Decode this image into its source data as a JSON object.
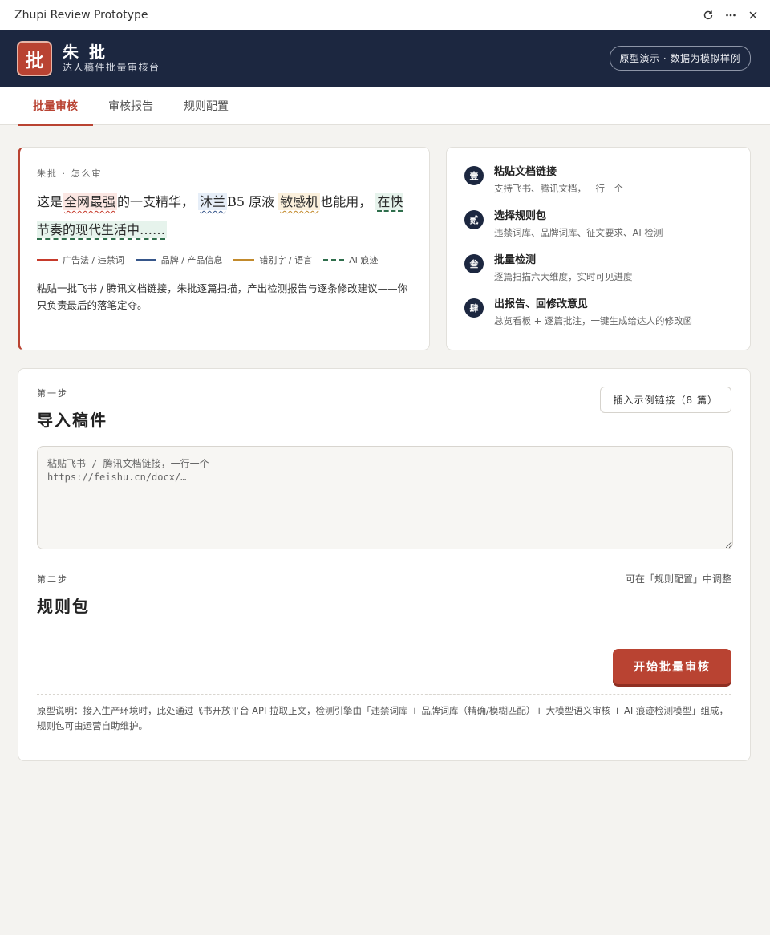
{
  "window": {
    "title": "Zhupi Review Prototype",
    "refresh_icon": "refresh-icon",
    "more_icon": "more-icon",
    "close_icon": "close-icon"
  },
  "header": {
    "logo_char": "批",
    "app_name": "朱 批",
    "subtitle": "达人稿件批量审核台",
    "pill": "原型演示 · 数据为模拟样例",
    "colors": {
      "header_bg": "#1c2740",
      "accent": "#b94332"
    }
  },
  "tabs": [
    {
      "label": "批量审核",
      "active": true
    },
    {
      "label": "审核报告",
      "active": false
    },
    {
      "label": "规则配置",
      "active": false
    }
  ],
  "intro": {
    "kicker": "朱批 · 怎么审",
    "sample": [
      {
        "text": "这是",
        "mark": ""
      },
      {
        "text": "全网最强",
        "mark": "ad"
      },
      {
        "text": "的一支精华，",
        "mark": ""
      },
      {
        "text": "沐兰",
        "mark": "brand"
      },
      {
        "text": "B5 原液",
        "mark": ""
      },
      {
        "text": "敏感机",
        "mark": "typo"
      },
      {
        "text": "也能用，",
        "mark": ""
      },
      {
        "text": "在快节奏的现代生活中……",
        "mark": "ai"
      }
    ],
    "legend": [
      {
        "label": "广告法 / 违禁词",
        "color": "#c63a2b",
        "style": "solid"
      },
      {
        "label": "品牌 / 产品信息",
        "color": "#36568a",
        "style": "solid"
      },
      {
        "label": "错别字 / 语言",
        "color": "#c28a2c",
        "style": "solid"
      },
      {
        "label": "AI 痕迹",
        "color": "#2f6e4c",
        "style": "dashed"
      }
    ],
    "description": "粘贴一批飞书 / 腾讯文档链接，朱批逐篇扫描，产出检测报告与逐条修改建议——你只负责最后的落笔定夺。"
  },
  "steps": [
    {
      "num": "壹",
      "title": "粘贴文档链接",
      "desc": "支持飞书、腾讯文档，一行一个"
    },
    {
      "num": "贰",
      "title": "选择规则包",
      "desc": "违禁词库、品牌词库、征文要求、AI 检测"
    },
    {
      "num": "叁",
      "title": "批量检测",
      "desc": "逐篇扫描六大维度，实时可见进度"
    },
    {
      "num": "肆",
      "title": "出报告、回修改意见",
      "desc": "总览看板 + 逐篇批注，一键生成给达人的修改函"
    }
  ],
  "import_section": {
    "step_label": "第一步",
    "title": "导入稿件",
    "insert_button": "插入示例链接（8 篇）",
    "placeholder": "粘贴飞书 / 腾讯文档链接，一行一个\nhttps://feishu.cn/docx/…",
    "value": ""
  },
  "rules_section": {
    "step_label": "第二步",
    "title": "规则包",
    "hint": "可在「规则配置」中调整"
  },
  "start_button": "开始批量审核",
  "footnote": "原型说明：接入生产环境时，此处通过飞书开放平台 API 拉取正文，检测引擎由「违禁词库 + 品牌词库（精确/模糊匹配）+ 大模型语义审核 + AI 痕迹检测模型」组成，规则包可由运营自助维护。"
}
